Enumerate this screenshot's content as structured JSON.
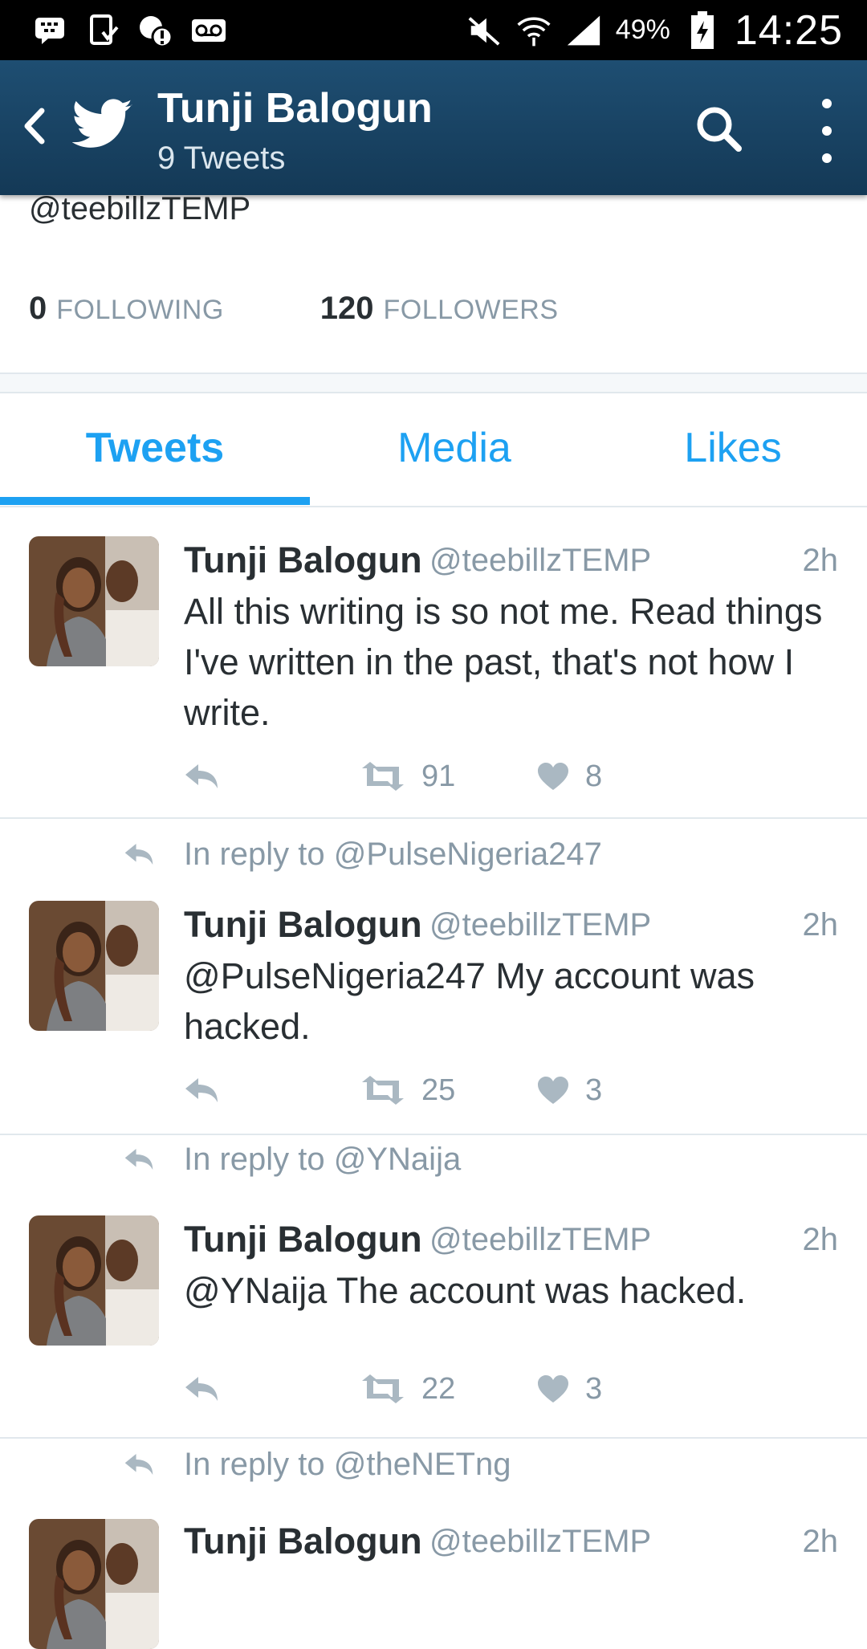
{
  "status_bar": {
    "battery": "49%",
    "time": "14:25",
    "icons": [
      "bbm-icon",
      "download-icon",
      "alert-icon",
      "voicemail-icon",
      "mute-icon",
      "wifi-icon",
      "signal-icon",
      "battery-icon"
    ]
  },
  "app_bar": {
    "title": "Tunji Balogun",
    "subtitle": "9 Tweets",
    "accent": "#1e4e72"
  },
  "profile": {
    "handle": "@teebillzTEMP",
    "following_count": "0",
    "following_label": "FOLLOWING",
    "followers_count": "120",
    "followers_label": "FOLLOWERS"
  },
  "tabs": [
    {
      "label": "Tweets",
      "active": true
    },
    {
      "label": "Media",
      "active": false
    },
    {
      "label": "Likes",
      "active": false
    }
  ],
  "tweets": [
    {
      "reply_to": "",
      "name": "Tunji Balogun",
      "handle": "@teebillzTEMP",
      "time": "2h",
      "text": "All this writing is so not me. Read things I've written in the past, that's not how I write.",
      "retweets": "91",
      "likes": "8"
    },
    {
      "reply_to": "In reply to @PulseNigeria247",
      "name": "Tunji Balogun",
      "handle": "@teebillzTEMP",
      "time": "2h",
      "text": "@PulseNigeria247 My account was hacked.",
      "retweets": "25",
      "likes": "3"
    },
    {
      "reply_to": "In reply to @YNaija",
      "name": "Tunji Balogun",
      "handle": "@teebillzTEMP",
      "time": "2h",
      "text": "@YNaija The account was hacked.",
      "retweets": "22",
      "likes": "3"
    },
    {
      "reply_to": "In reply to @theNETng",
      "name": "Tunji Balogun",
      "handle": "@teebillzTEMP",
      "time": "2h",
      "text": "",
      "retweets": "",
      "likes": ""
    }
  ],
  "colors": {
    "twitter_blue": "#1da1f2",
    "muted_text": "#8899a6",
    "dark_text": "#292f33",
    "divider": "#e1e8ed"
  }
}
